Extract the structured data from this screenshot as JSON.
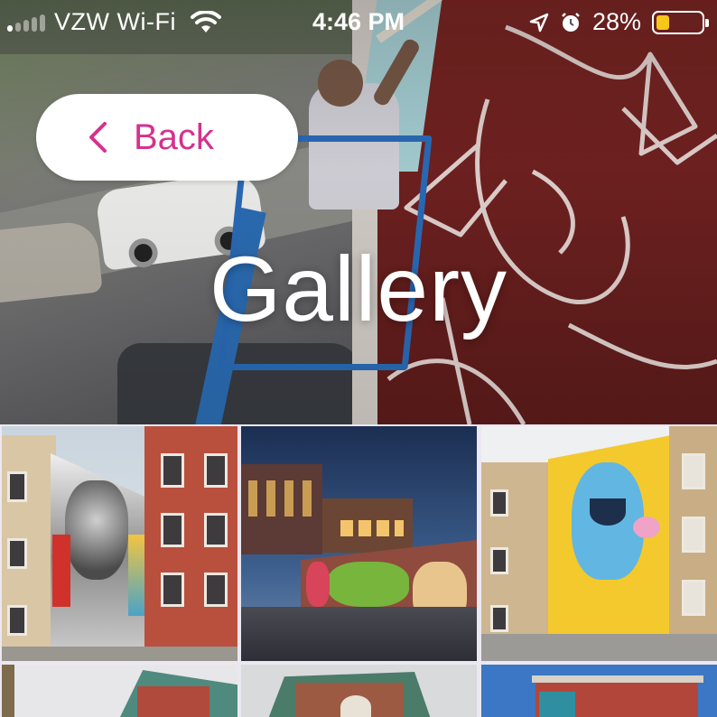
{
  "status_bar": {
    "carrier": "VZW Wi-Fi",
    "time": "4:46 PM",
    "battery_percent_label": "28%",
    "battery_level": 0.28,
    "battery_color": "#f6c619",
    "icons": [
      "signal-icon",
      "wifi-icon",
      "location-arrow-icon",
      "alarm-icon",
      "battery-icon"
    ]
  },
  "header": {
    "back_label": "Back",
    "title": "Gallery",
    "accent_color": "#d6318f"
  },
  "gallery": {
    "tiles": [
      {
        "subject": "brick-apartment-with-face-portrait-mural"
      },
      {
        "subject": "street-corner-with-graffiti-wall-at-dusk"
      },
      {
        "subject": "beige-building-with-blue-cartoon-character-mural"
      },
      {
        "subject": "teal-building-partial"
      },
      {
        "subject": "brick-building-with-arch-window-partial"
      },
      {
        "subject": "red-brick-building-with-mural-partial"
      }
    ]
  }
}
